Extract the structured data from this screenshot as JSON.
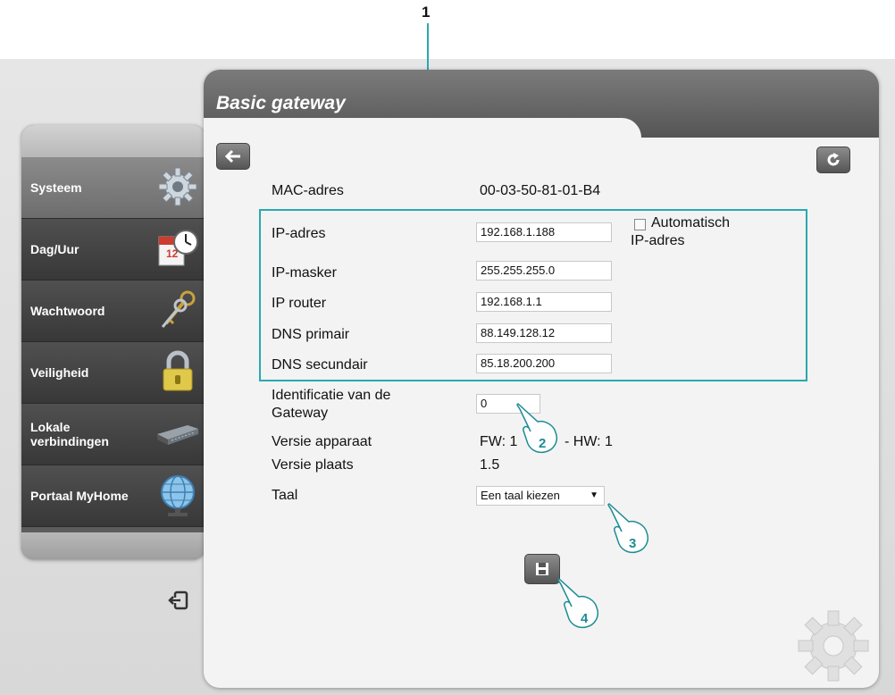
{
  "callouts": {
    "box": "1",
    "input": "2",
    "select": "3",
    "save": "4"
  },
  "sidebar": {
    "items": [
      {
        "label": "Systeem",
        "icon": "gear-icon"
      },
      {
        "label": "Dag/Uur",
        "icon": "calendar-clock-icon"
      },
      {
        "label": "Wachtwoord",
        "icon": "keys-icon"
      },
      {
        "label": "Veiligheid",
        "icon": "padlock-icon"
      },
      {
        "label": "Lokale\nverbindingen",
        "icon": "network-switch-icon"
      },
      {
        "label": "Portaal MyHome",
        "icon": "globe-icon"
      }
    ]
  },
  "panel": {
    "title": "Basic gateway",
    "back_icon": "arrow-left-icon",
    "refresh_icon": "refresh-icon"
  },
  "form": {
    "mac": {
      "label": "MAC-adres",
      "value": "00-03-50-81-01-B4"
    },
    "ip": {
      "label": "IP-adres",
      "value": "192.168.1.188"
    },
    "auto_ip": {
      "label_line1": "Automatisch",
      "label_line2": "IP-adres",
      "checked": false
    },
    "mask": {
      "label": "IP-masker",
      "value": "255.255.255.0"
    },
    "router": {
      "label": "IP router",
      "value": "192.168.1.1"
    },
    "dns1": {
      "label": "DNS primair",
      "value": "88.149.128.12"
    },
    "dns2": {
      "label": "DNS secundair",
      "value": "85.18.200.200"
    },
    "gateway_id": {
      "label_line1": "Identificatie van de",
      "label_line2": "Gateway",
      "value": "0"
    },
    "device_version": {
      "label": "Versie apparaat",
      "fw_prefix": "FW: 1",
      "hw": "- HW: 1"
    },
    "site_version": {
      "label": "Versie plaats",
      "value": "1.5"
    },
    "language": {
      "label": "Taal",
      "selected": "Een taal kiezen"
    }
  },
  "colors": {
    "accent": "#2aa8b0",
    "header": "#5a5a5a"
  }
}
